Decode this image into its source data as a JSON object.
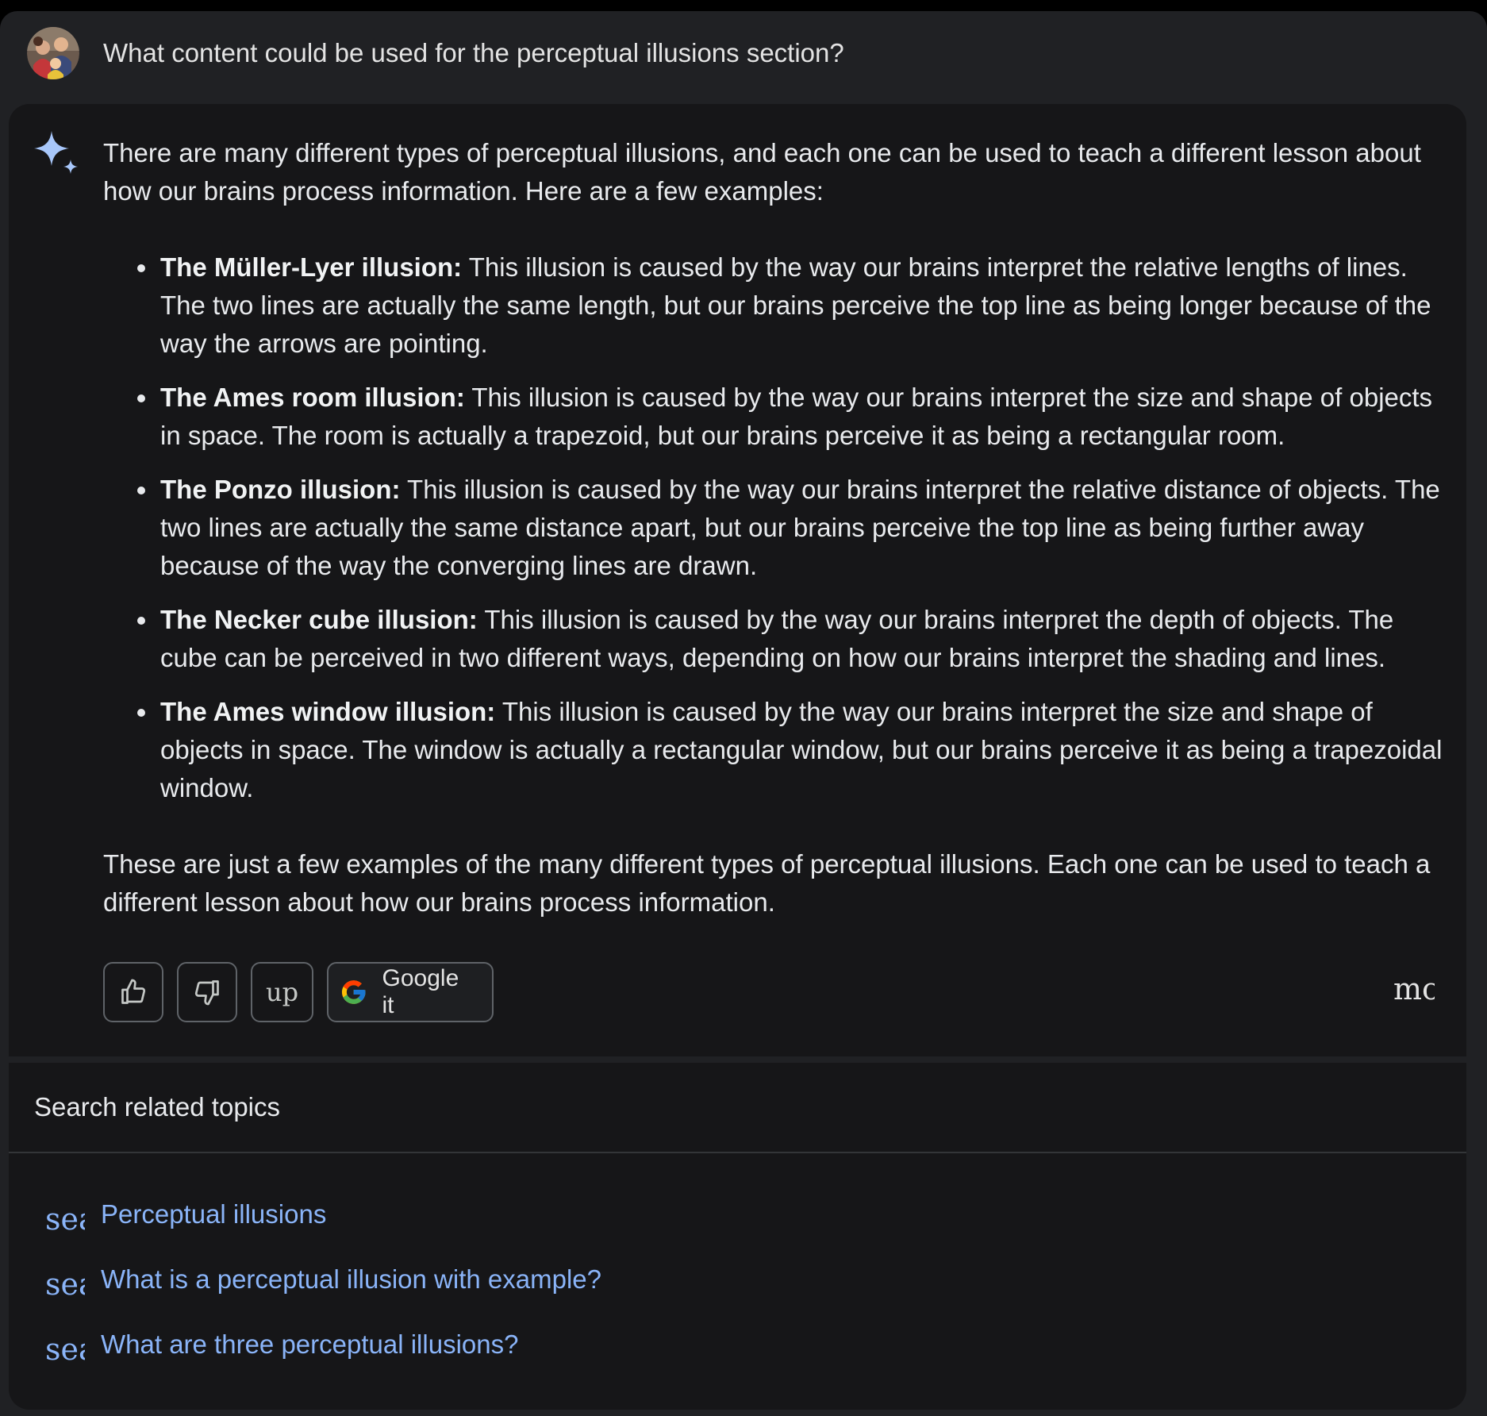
{
  "prompt": {
    "text": "What content could be used for the perceptual illusions section?"
  },
  "response": {
    "intro": "There are many different types of perceptual illusions, and each one can be used to teach a different lesson about how our brains process information. Here are a few examples:",
    "items": [
      {
        "term": "The Müller-Lyer illusion:",
        "text": " This illusion is caused by the way our brains interpret the relative lengths of lines. The two lines are actually the same length, but our brains perceive the top line as being longer because of the way the arrows are pointing."
      },
      {
        "term": "The Ames room illusion:",
        "text": " This illusion is caused by the way our brains interpret the size and shape of objects in space. The room is actually a trapezoid, but our brains perceive it as being a rectangular room."
      },
      {
        "term": "The Ponzo illusion:",
        "text": " This illusion is caused by the way our brains interpret the relative distance of objects. The two lines are actually the same distance apart, but our brains perceive the top line as being further away because of the way the converging lines are drawn."
      },
      {
        "term": "The Necker cube illusion:",
        "text": " This illusion is caused by the way our brains interpret the depth of objects. The cube can be perceived in two different ways, depending on how our brains interpret the shading and lines."
      },
      {
        "term": "The Ames window illusion:",
        "text": " This illusion is caused by the way our brains interpret the size and shape of objects in space. The window is actually a rectangular window, but our brains perceive it as being a trapezoidal window."
      }
    ],
    "outro": "These are just a few examples of the many different types of perceptual illusions. Each one can be used to teach a different lesson about how our brains process information."
  },
  "actions": {
    "thumb_up_icon": "thumb-up",
    "thumb_down_icon": "thumb-down",
    "up_label": "up",
    "google_label": "Google it",
    "more_label": "mc"
  },
  "related": {
    "header": "Search related topics",
    "icon_text": "sea",
    "items": [
      "Perceptual illusions",
      "What is a perceptual illusion with example?",
      "What are three perceptual illusions?"
    ]
  },
  "colors": {
    "page_bg": "#202124",
    "card_bg": "#161618",
    "text": "#e8eaed",
    "link": "#8ab4f8",
    "sparkle": "#a8c7fa",
    "button_border": "#5f6368"
  }
}
